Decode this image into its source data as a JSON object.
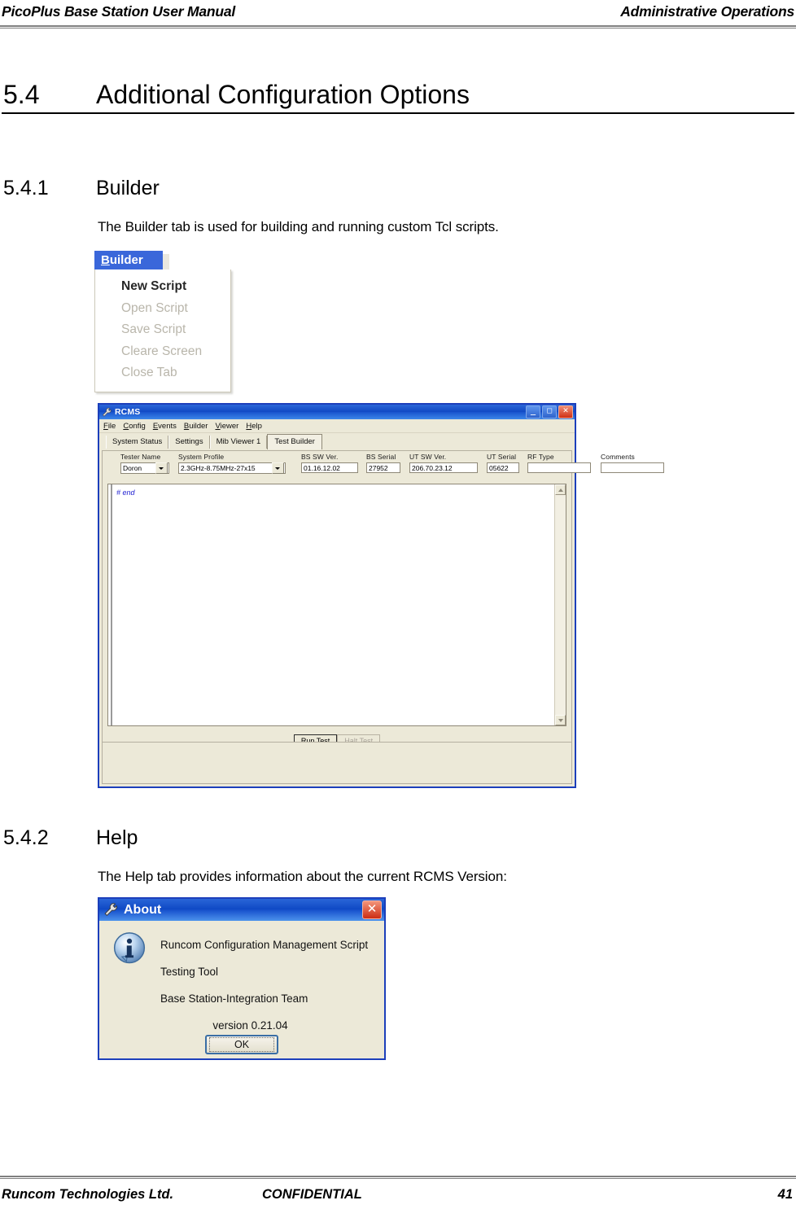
{
  "header": {
    "left": "PicoPlus Base Station User Manual",
    "right": "Administrative Operations"
  },
  "section": {
    "number": "5.4",
    "title": "Additional Configuration Options"
  },
  "subsections": [
    {
      "number": "5.4.1",
      "title": "Builder",
      "body": "The Builder tab is used for building and running custom Tcl scripts."
    },
    {
      "number": "5.4.2",
      "title": "Help",
      "body": "The Help tab provides information about the current RCMS Version:"
    }
  ],
  "builder_menu": {
    "tab_label_pre": "B",
    "tab_label_post": "uilder",
    "items": [
      {
        "label": "New Script",
        "enabled": true
      },
      {
        "label": "Open Script",
        "enabled": false
      },
      {
        "label": "Save Script",
        "enabled": false
      },
      {
        "label": "Cleare Screen",
        "enabled": false
      },
      {
        "label": "Close Tab",
        "enabled": false
      }
    ]
  },
  "rcms_window": {
    "title": "RCMS",
    "title_icon": "wrench-icon",
    "window_buttons": {
      "minimize": "minimize-icon",
      "maximize": "maximize-icon",
      "close": "close-icon"
    },
    "menus": [
      {
        "mnemonic": "F",
        "rest": "ile"
      },
      {
        "mnemonic": "C",
        "rest": "onfig"
      },
      {
        "mnemonic": "E",
        "rest": "vents"
      },
      {
        "mnemonic": "B",
        "rest": "uilder"
      },
      {
        "mnemonic": "V",
        "rest": "iewer"
      },
      {
        "mnemonic": "H",
        "rest": "elp"
      }
    ],
    "tabs": [
      {
        "label": "System Status",
        "active": false
      },
      {
        "label": "Settings",
        "active": false
      },
      {
        "label": "Mib Viewer 1",
        "active": false
      },
      {
        "label": "Test Builder",
        "active": true
      }
    ],
    "fields": {
      "tester_name": {
        "label": "Tester Name",
        "value": "Doron",
        "type": "combo"
      },
      "system_profile": {
        "label": "System Profile",
        "value": "2.3GHz-8.75MHz-27x15",
        "type": "combo"
      },
      "bs_sw_ver": {
        "label": "BS SW Ver.",
        "value": "01.16.12.02",
        "type": "text"
      },
      "bs_serial": {
        "label": "BS Serial",
        "value": "27952",
        "type": "text"
      },
      "ut_sw_ver": {
        "label": "UT SW Ver.",
        "value": "206.70.23.12",
        "type": "text"
      },
      "ut_serial": {
        "label": "UT Serial",
        "value": "05622",
        "type": "text"
      },
      "rf_type": {
        "label": "RF Type",
        "value": "",
        "type": "text"
      },
      "comments": {
        "label": "Comments",
        "value": "",
        "type": "text"
      }
    },
    "editor": {
      "content": "# end"
    },
    "buttons": [
      {
        "label": "Run Test",
        "enabled": true
      },
      {
        "label": "Halt Test",
        "enabled": false
      }
    ],
    "scrollbar": {
      "up": "scroll-up-icon",
      "down": "scroll-down-icon"
    }
  },
  "about_dialog": {
    "title": "About",
    "title_icon": "wrench-icon",
    "close_glyph": "✕",
    "info_icon": "info-icon",
    "lines": [
      "Runcom Configuration Management Script",
      "Testing Tool",
      "Base Station-Integration Team"
    ],
    "version": "version 0.21.04",
    "ok_label": "OK"
  },
  "footer": {
    "left": "Runcom Technologies Ltd.",
    "center": "CONFIDENTIAL",
    "right": "41"
  }
}
